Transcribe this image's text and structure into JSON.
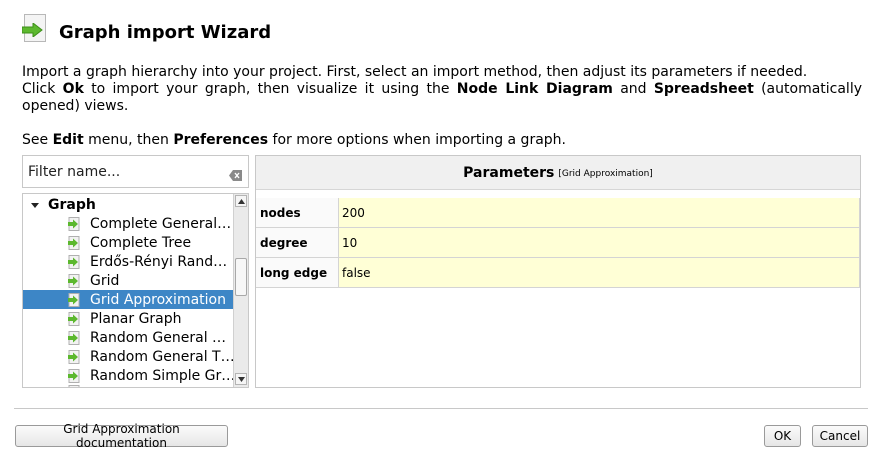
{
  "dialog": {
    "title": "Graph import Wizard",
    "desc_line1": "Import a graph hierarchy into your project. First, select an import method, then adjust its parameters if needed.",
    "desc_line2_a": "Click ",
    "desc_line2_ok": "Ok",
    "desc_line2_b": " to import your graph, then visualize it using the ",
    "desc_line2_nld": "Node Link Diagram",
    "desc_line2_c": " and ",
    "desc_line2_ss": "Spreadsheet",
    "desc_line2_d": " (automatically opened) views.",
    "desc_line3_a": "See ",
    "desc_line3_edit": "Edit",
    "desc_line3_b": " menu, then ",
    "desc_line3_pref": "Preferences",
    "desc_line3_c": " for more options when importing a graph."
  },
  "filter": {
    "placeholder": "Filter name..."
  },
  "tree": {
    "root": "Graph",
    "items": [
      "Complete General…",
      "Complete Tree",
      "Erdős-Rényi Rand…",
      "Grid",
      "Grid Approximation",
      "Planar Graph",
      "Random General …",
      "Random General T…",
      "Random Simple Gr…"
    ],
    "selected_index": 4
  },
  "params": {
    "title": "Parameters",
    "subtitle": "[Grid Approximation]",
    "rows": [
      {
        "name": "nodes",
        "value": "200"
      },
      {
        "name": "degree",
        "value": "10"
      },
      {
        "name": "long edge",
        "value": "false"
      }
    ]
  },
  "buttons": {
    "doc": "Grid Approximation documentation",
    "ok": "OK",
    "cancel": "Cancel"
  },
  "colors": {
    "selection": "#3d86c6",
    "param_value_bg": "#ffffd6",
    "icon_green": "#5cb82e"
  },
  "icons": {
    "header": "import-arrow-page-icon",
    "item": "plugin-arrow-icon",
    "clear": "clear-text-icon"
  }
}
